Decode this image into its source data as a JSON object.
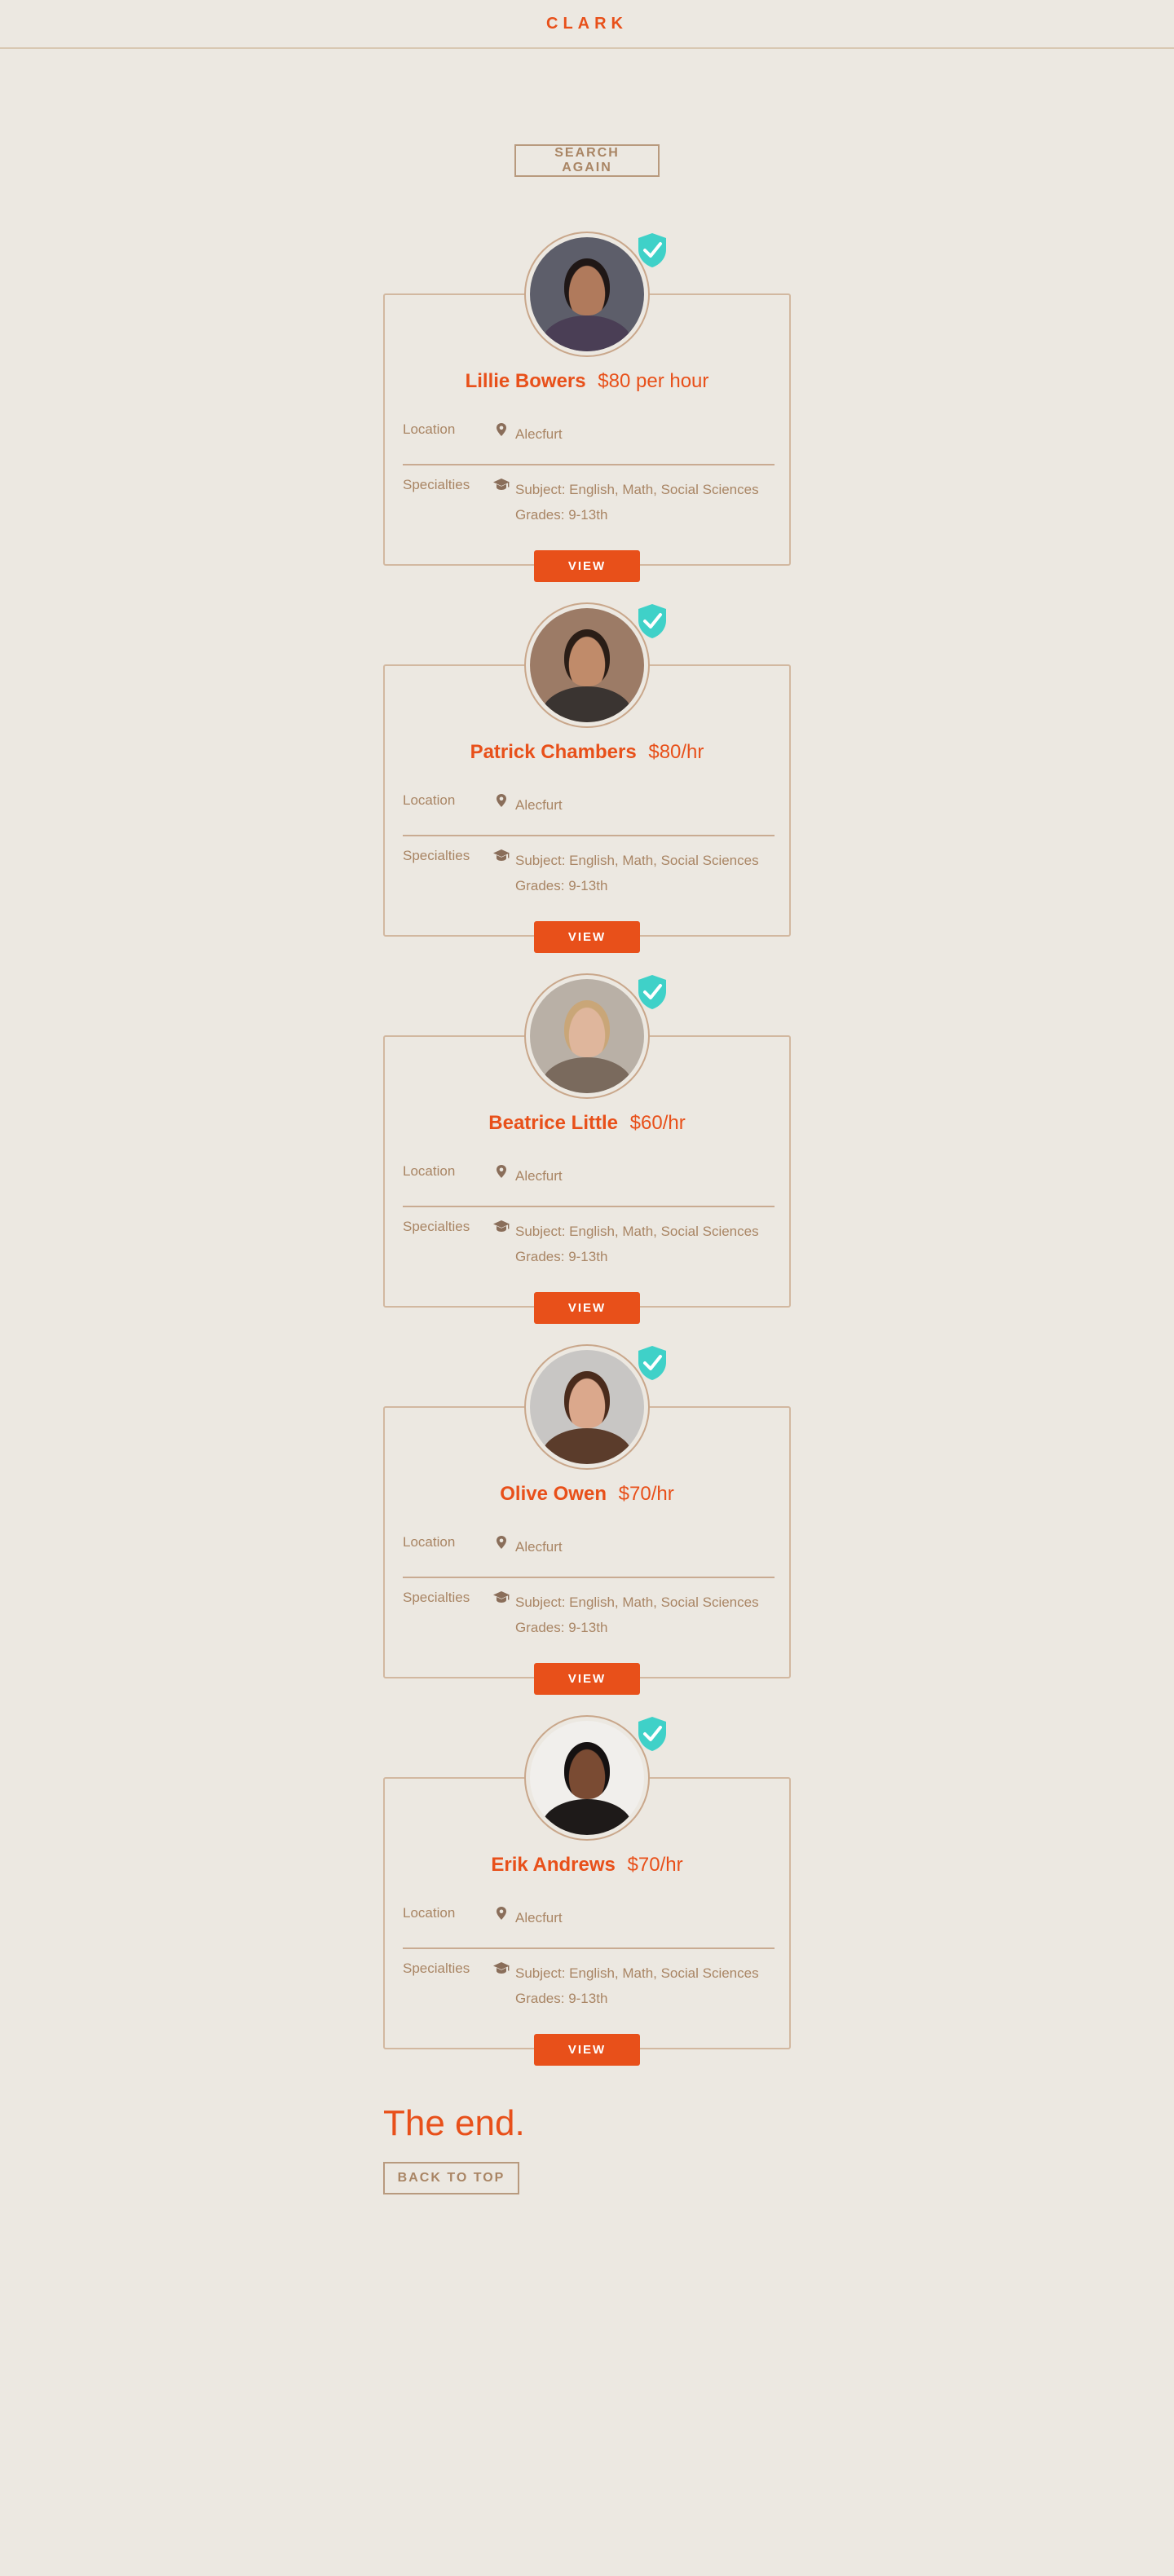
{
  "header": {
    "brand": "CLARK"
  },
  "search": {
    "button_label": "SEARCH AGAIN"
  },
  "labels": {
    "location": "Location",
    "specialties": "Specialties",
    "view": "VIEW"
  },
  "icons": {
    "verified": "shield-check-icon",
    "location": "map-pin-icon",
    "specialties": "graduation-cap-icon"
  },
  "colors": {
    "accent": "#e8501a",
    "verified_badge": "#3fd1c8",
    "background": "#ece8e1",
    "muted_text": "#a98564"
  },
  "tutors": [
    {
      "name": "Lillie Bowers",
      "rate": "$80 per hour",
      "location": "Alecfurt",
      "subject": "Subject: English, Math, Social Sciences",
      "grades": "Grades: 9-13th",
      "verified": true,
      "avatar": {
        "bg": "#5d5e6a",
        "skin": "#b07a5c",
        "hair": "#1f1716",
        "shirt": "#4a3e55"
      }
    },
    {
      "name": "Patrick Chambers",
      "rate": "$80/hr",
      "location": "Alecfurt",
      "subject": "Subject: English, Math, Social Sciences",
      "grades": "Grades: 9-13th",
      "verified": true,
      "avatar": {
        "bg": "#9c7b66",
        "skin": "#c08b6a",
        "hair": "#2a1d16",
        "shirt": "#3a3431"
      }
    },
    {
      "name": "Beatrice Little",
      "rate": "$60/hr",
      "location": "Alecfurt",
      "subject": "Subject: English, Math, Social Sciences",
      "grades": "Grades: 9-13th",
      "verified": true,
      "avatar": {
        "bg": "#b9b0a6",
        "skin": "#dfb69c",
        "hair": "#c9a678",
        "shirt": "#7a6a5d"
      }
    },
    {
      "name": "Olive Owen",
      "rate": "$70/hr",
      "location": "Alecfurt",
      "subject": "Subject: English, Math, Social Sciences",
      "grades": "Grades: 9-13th",
      "verified": true,
      "avatar": {
        "bg": "#c8c6c4",
        "skin": "#dba88c",
        "hair": "#4a2b1c",
        "shirt": "#5b3c2b"
      }
    },
    {
      "name": "Erik Andrews",
      "rate": "$70/hr",
      "location": "Alecfurt",
      "subject": "Subject: English, Math, Social Sciences",
      "grades": "Grades: 9-13th",
      "verified": true,
      "avatar": {
        "bg": "#f1efec",
        "skin": "#7a4b33",
        "hair": "#151111",
        "shirt": "#1e1a19"
      }
    }
  ],
  "footer": {
    "end_text": "The end.",
    "back_to_top": "BACK TO TOP"
  }
}
